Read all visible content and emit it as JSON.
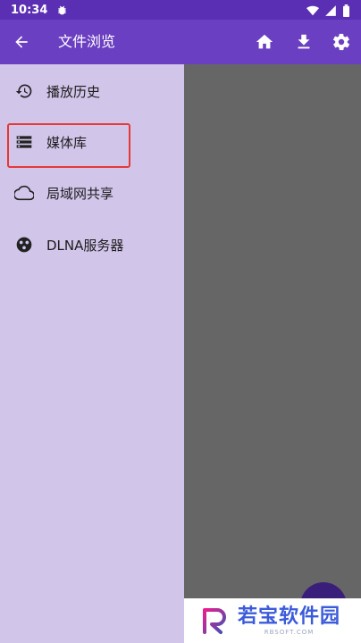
{
  "status_bar": {
    "time": "10:34",
    "notification_icon": "bug-icon",
    "icons": [
      "wifi-icon",
      "signal-icon",
      "battery-icon"
    ]
  },
  "toolbar": {
    "title": "文件浏览",
    "back_icon": "arrow-back-icon",
    "actions": [
      "home-icon",
      "download-icon",
      "settings-icon"
    ]
  },
  "drawer": {
    "items": [
      {
        "label": "播放历史",
        "icon": "history-icon"
      },
      {
        "label": "媒体库",
        "icon": "storage-icon"
      },
      {
        "label": "局域网共享",
        "icon": "cloud-icon"
      },
      {
        "label": "DLNA服务器",
        "icon": "dlna-icon"
      }
    ],
    "highlighted_item": "媒体库"
  },
  "watermark": {
    "text": "若宝软件园",
    "sub": "RBSOFT.COM"
  },
  "colors": {
    "status_bar": "#5b2fb3",
    "toolbar": "#6a3fc1",
    "drawer_bg": "#d2c5ea",
    "scrim": "#666666",
    "highlight": "#e53935"
  }
}
